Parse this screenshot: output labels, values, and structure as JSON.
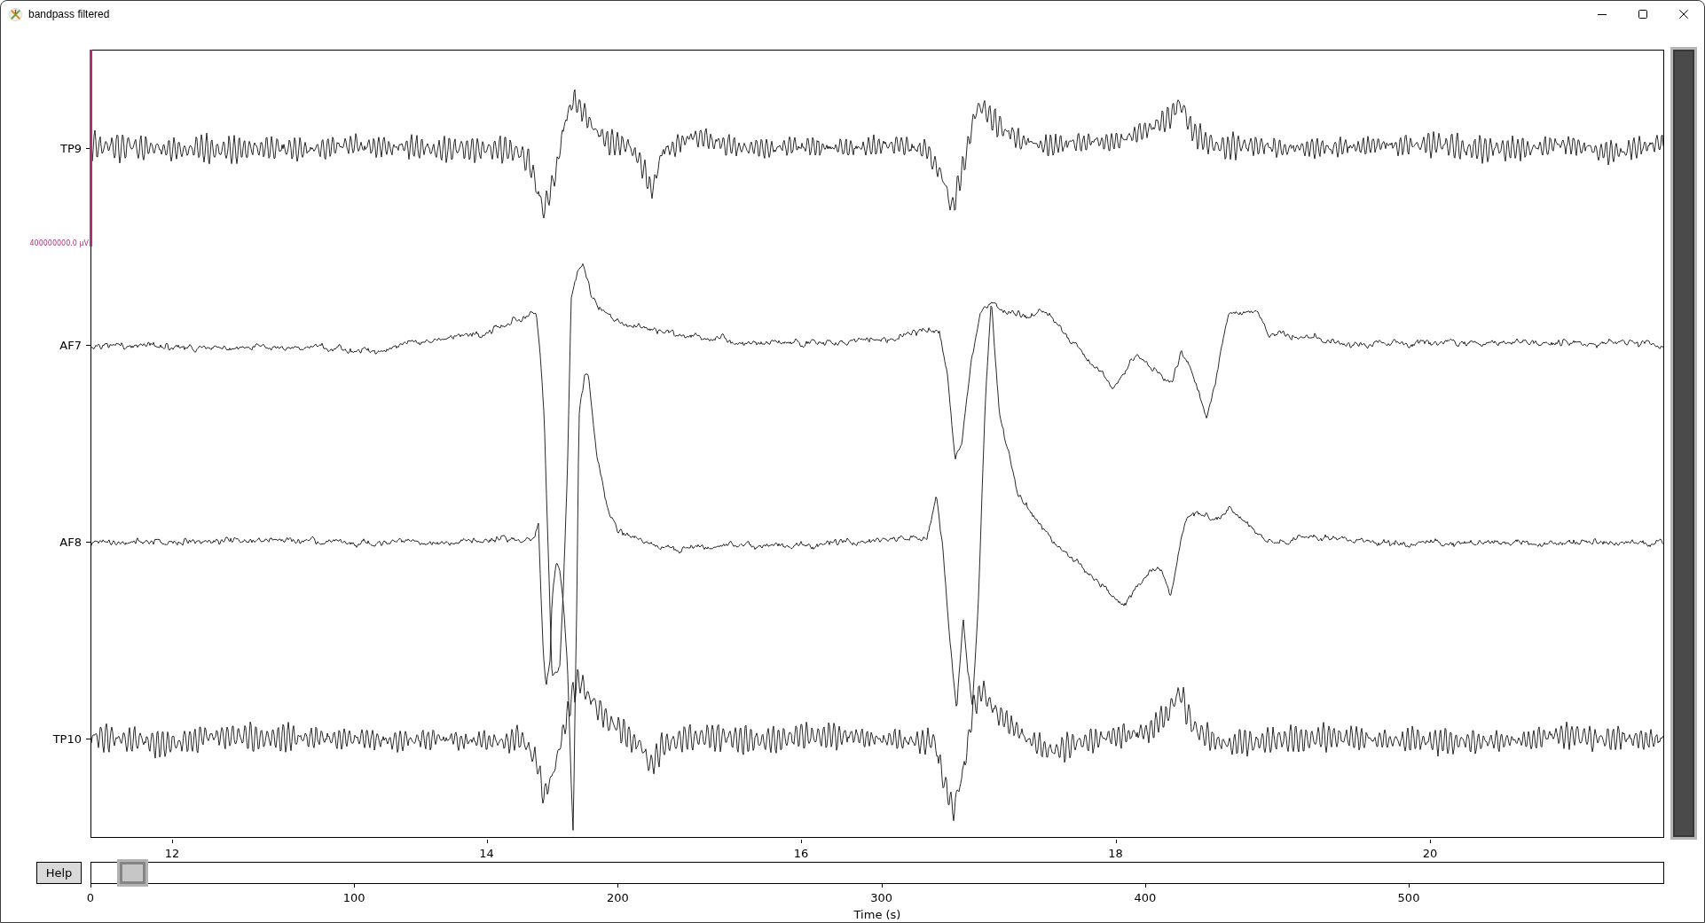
{
  "window": {
    "title": "bandpass filtered"
  },
  "plot": {
    "channels": [
      {
        "name": "TP9"
      },
      {
        "name": "AF7"
      },
      {
        "name": "AF8"
      },
      {
        "name": "TP10"
      }
    ],
    "scale_label": "400000000.0 µV",
    "x_ticks": [
      "12",
      "14",
      "16",
      "18",
      "20"
    ]
  },
  "help_button": {
    "label": "Help"
  },
  "overview": {
    "x_ticks": [
      "0",
      "100",
      "200",
      "300",
      "400",
      "500"
    ],
    "xlabel": "Time (s)"
  }
}
